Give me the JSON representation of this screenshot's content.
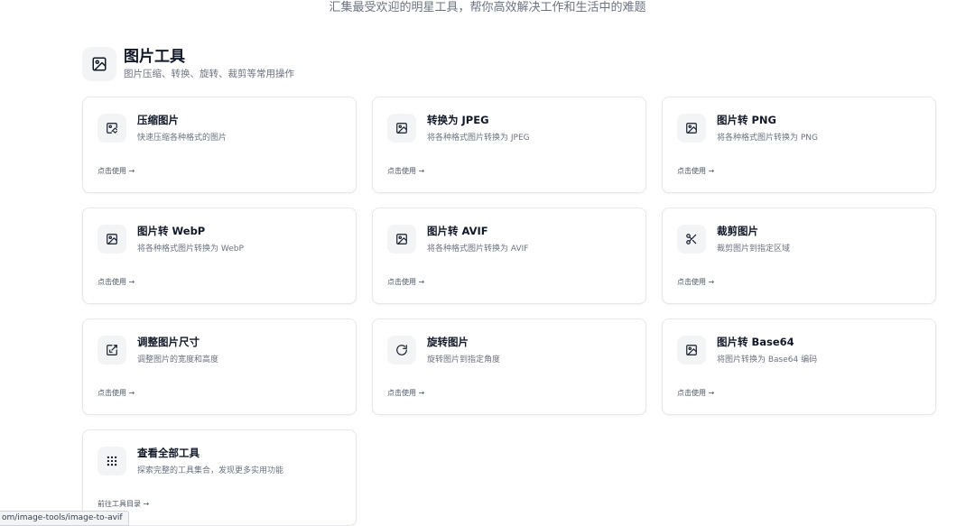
{
  "header": {
    "subtitle": "汇集最受欢迎的明星工具，帮你高效解决工作和生活中的难题"
  },
  "section": {
    "icon": "image-icon",
    "title": "图片工具",
    "description": "图片压缩、转换、旋转、裁剪等常用操作"
  },
  "cards": [
    {
      "icon": "image-compress-icon",
      "title": "压缩图片",
      "description": "快速压缩各种格式的图片",
      "link": "点击使用 →"
    },
    {
      "icon": "image-icon",
      "title": "转换为 JPEG",
      "description": "将各种格式图片转换为 JPEG",
      "link": "点击使用 →"
    },
    {
      "icon": "image-icon",
      "title": "图片转 PNG",
      "description": "将各种格式图片转换为 PNG",
      "link": "点击使用 →"
    },
    {
      "icon": "image-icon",
      "title": "图片转 WebP",
      "description": "将各种格式图片转换为 WebP",
      "link": "点击使用 →"
    },
    {
      "icon": "image-icon",
      "title": "图片转 AVIF",
      "description": "将各种格式图片转换为 AVIF",
      "link": "点击使用 →"
    },
    {
      "icon": "scissors-icon",
      "title": "裁剪图片",
      "description": "裁剪图片到指定区域",
      "link": "点击使用 →"
    },
    {
      "icon": "resize-icon",
      "title": "调整图片尺寸",
      "description": "调整图片的宽度和高度",
      "link": "点击使用 →"
    },
    {
      "icon": "rotate-icon",
      "title": "旋转图片",
      "description": "旋转图片到指定角度",
      "link": "点击使用 →"
    },
    {
      "icon": "image-icon",
      "title": "图片转 Base64",
      "description": "将图片转换为 Base64 编码",
      "link": "点击使用 →"
    },
    {
      "icon": "grid-dots-icon",
      "title": "查看全部工具",
      "description": "探索完整的工具集合，发现更多实用功能",
      "link": "前往工具目录 →"
    }
  ],
  "status_bar": {
    "url": "om/image-tools/image-to-avif"
  }
}
